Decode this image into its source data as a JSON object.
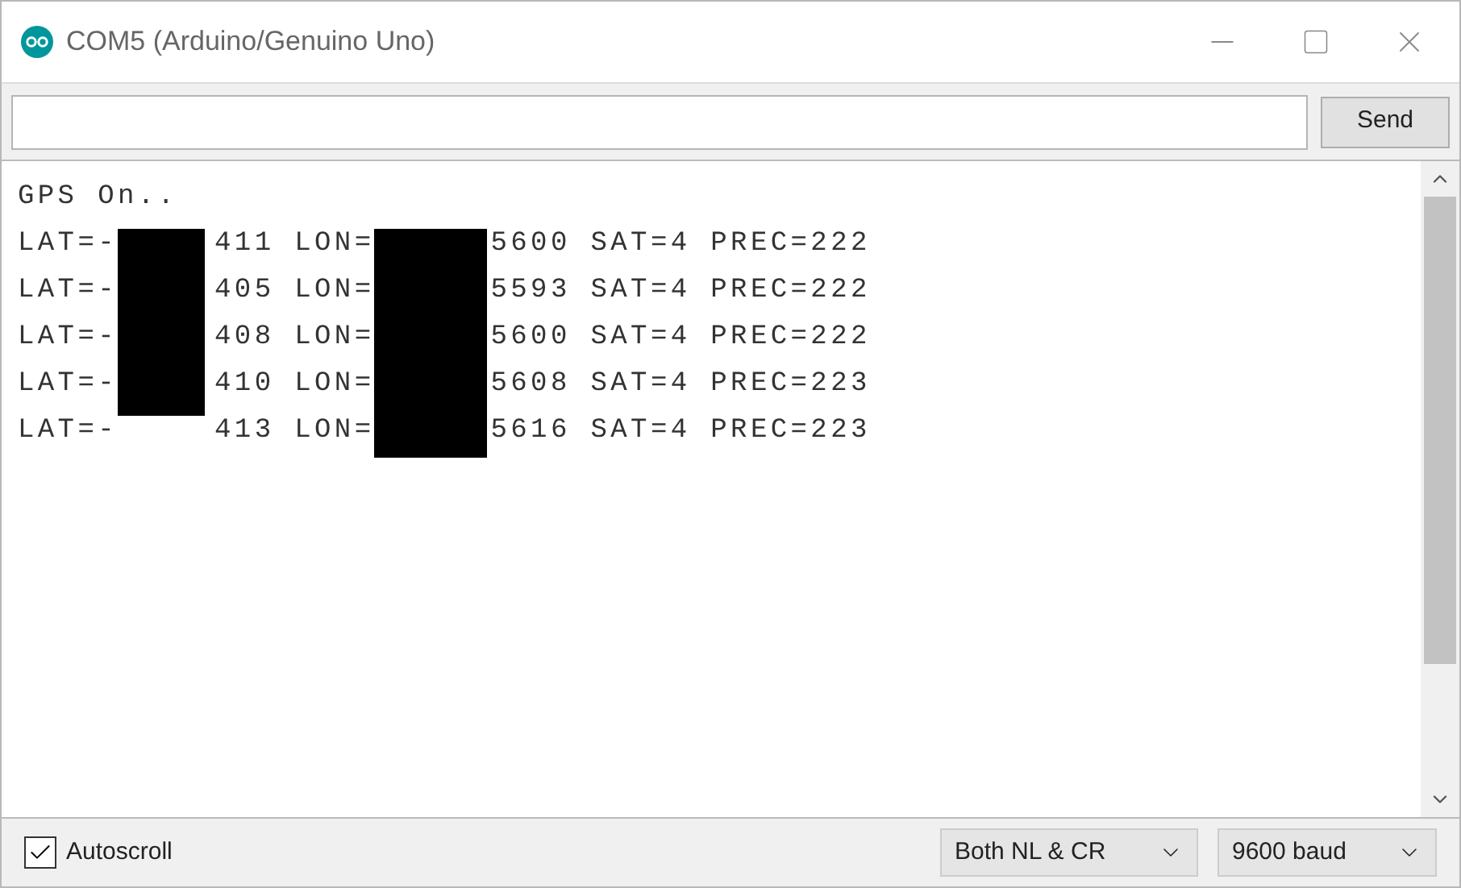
{
  "window": {
    "title": "COM5 (Arduino/Genuino Uno)"
  },
  "send_button": "Send",
  "output": [
    {
      "kind": "plain",
      "text": "GPS On.."
    },
    {
      "kind": "redacted",
      "parts": [
        "LAT=-",
        "411 LON=",
        "5600 SAT=4 PREC=222"
      ]
    },
    {
      "kind": "redacted",
      "parts": [
        "LAT=-",
        "405 LON=",
        "5593 SAT=4 PREC=222"
      ]
    },
    {
      "kind": "redacted",
      "parts": [
        "LAT=-",
        "408 LON=",
        "5600 SAT=4 PREC=222"
      ]
    },
    {
      "kind": "redacted",
      "parts": [
        "LAT=-",
        "410 LON=",
        "5608 SAT=4 PREC=223"
      ]
    },
    {
      "kind": "redacted",
      "parts": [
        "LAT=-",
        "413 LON=",
        "5616 SAT=4 PREC=223"
      ]
    }
  ],
  "autoscroll": {
    "label": "Autoscroll",
    "checked": true
  },
  "line_ending": "Both NL & CR",
  "baud_rate": "9600 baud"
}
